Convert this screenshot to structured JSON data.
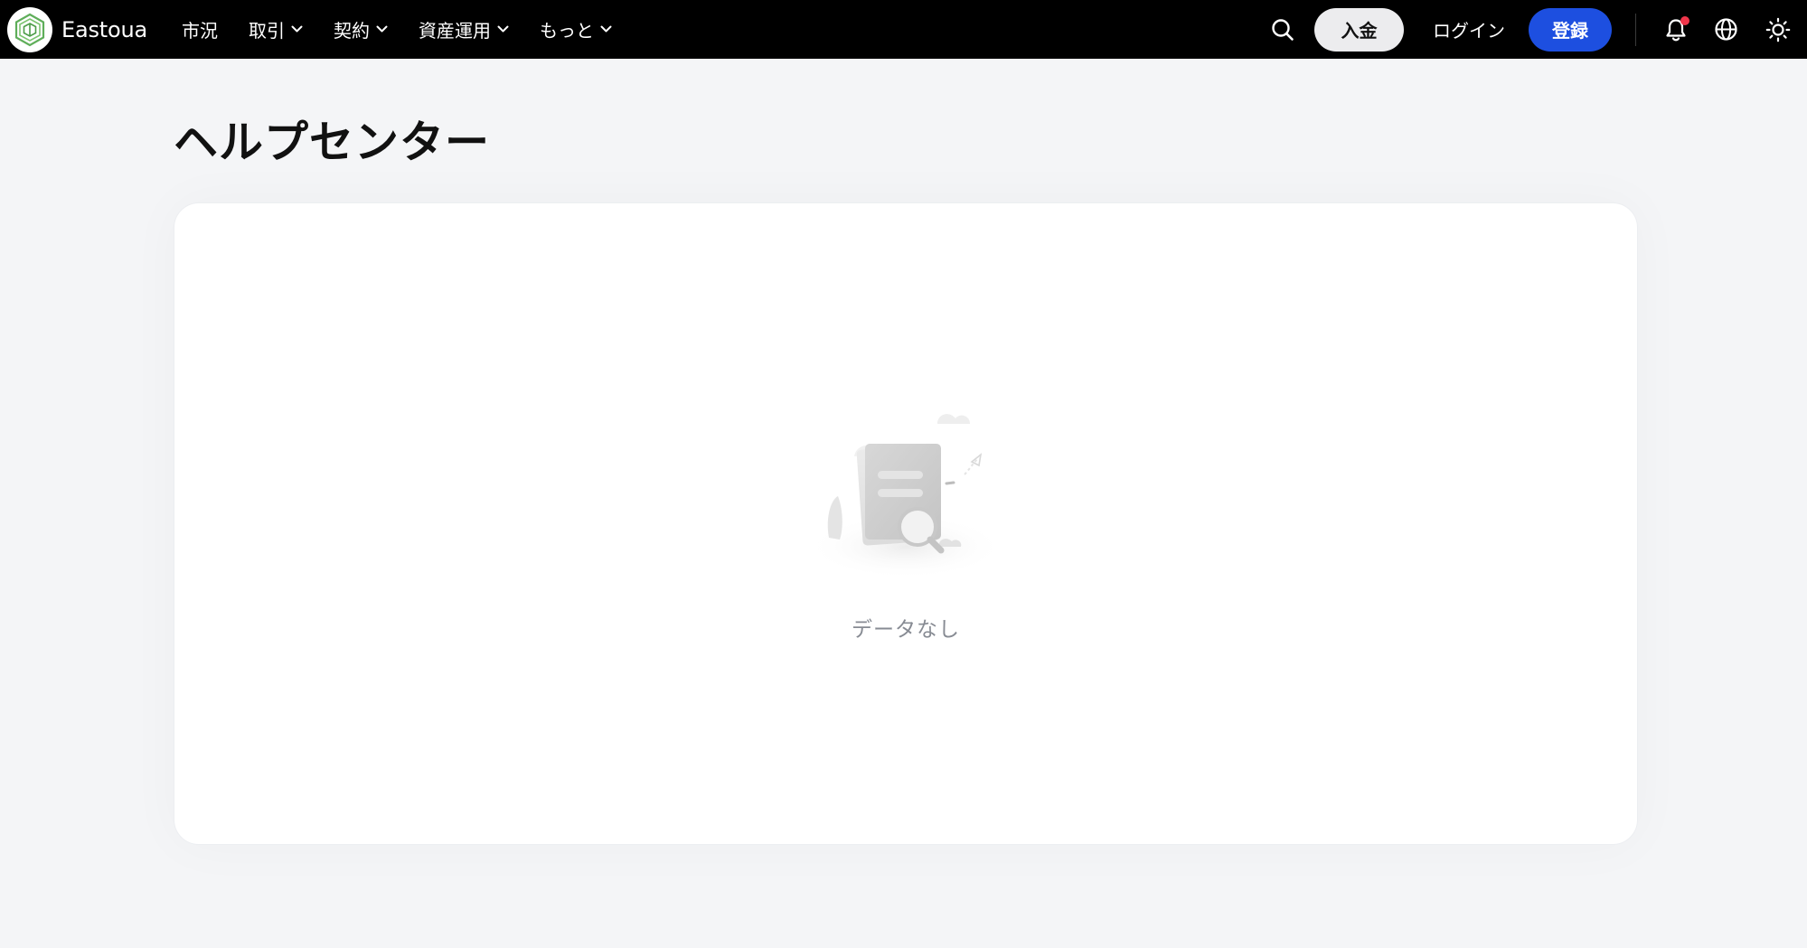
{
  "header": {
    "brand_name": "Eastoua",
    "nav": [
      {
        "label": "市況",
        "has_dropdown": false
      },
      {
        "label": "取引",
        "has_dropdown": true
      },
      {
        "label": "契約",
        "has_dropdown": true
      },
      {
        "label": "資産運用",
        "has_dropdown": true
      },
      {
        "label": "もっと",
        "has_dropdown": true
      }
    ],
    "deposit_label": "入金",
    "login_label": "ログイン",
    "register_label": "登録",
    "icons": {
      "search": "search-icon",
      "bell": "bell-icon",
      "globe": "globe-icon",
      "theme": "sun-icon"
    },
    "colors": {
      "bar_bg": "#000000",
      "register_bg": "#1d4fe0",
      "notification_dot": "#f0354a",
      "logo_green": "#5fae5a"
    }
  },
  "main": {
    "title": "ヘルプセンター",
    "empty_text": "データなし"
  }
}
